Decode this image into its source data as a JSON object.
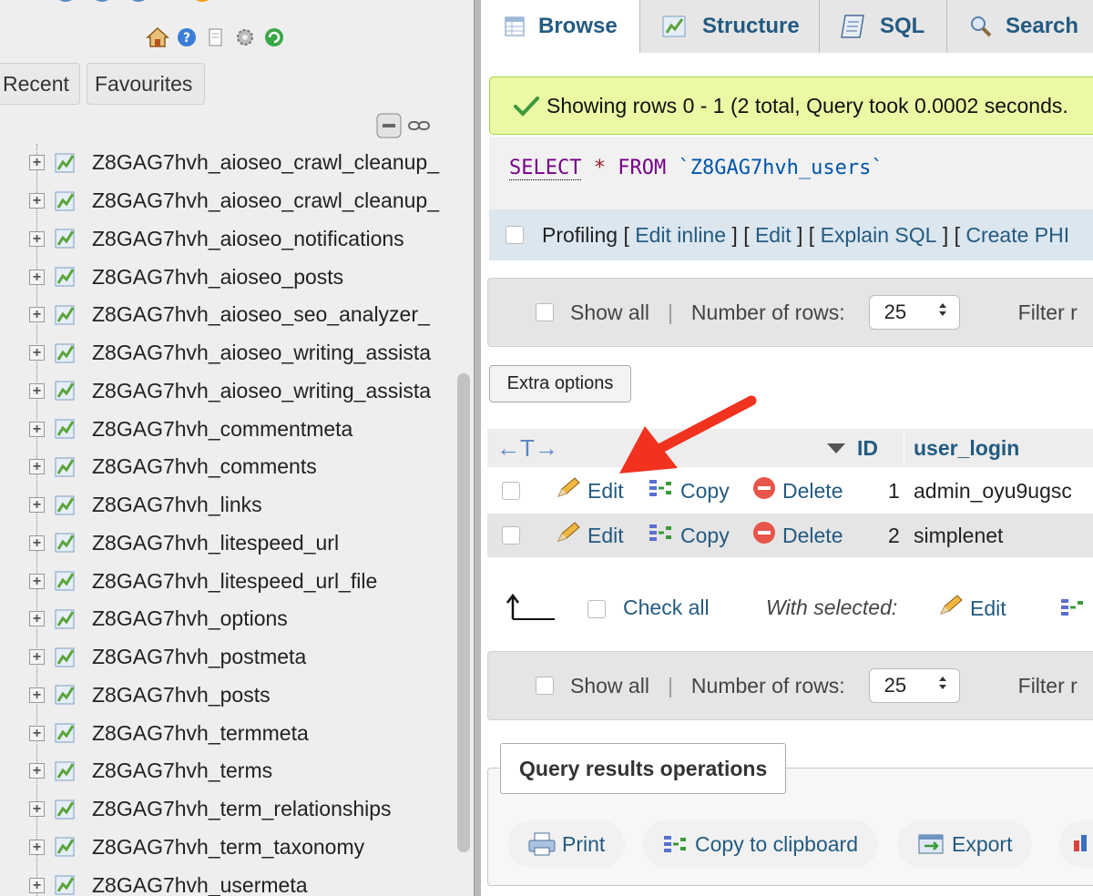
{
  "sidebar": {
    "nav_icons": [
      "home-icon",
      "help-icon",
      "docs-icon",
      "settings-icon",
      "reload-icon"
    ],
    "tabs": {
      "recent": "Recent",
      "favourites": "Favourites"
    },
    "tables": [
      "Z8GAG7hvh_aioseo_crawl_cleanup_",
      "Z8GAG7hvh_aioseo_crawl_cleanup_",
      "Z8GAG7hvh_aioseo_notifications",
      "Z8GAG7hvh_aioseo_posts",
      "Z8GAG7hvh_aioseo_seo_analyzer_",
      "Z8GAG7hvh_aioseo_writing_assista",
      "Z8GAG7hvh_aioseo_writing_assista",
      "Z8GAG7hvh_commentmeta",
      "Z8GAG7hvh_comments",
      "Z8GAG7hvh_links",
      "Z8GAG7hvh_litespeed_url",
      "Z8GAG7hvh_litespeed_url_file",
      "Z8GAG7hvh_options",
      "Z8GAG7hvh_postmeta",
      "Z8GAG7hvh_posts",
      "Z8GAG7hvh_termmeta",
      "Z8GAG7hvh_terms",
      "Z8GAG7hvh_term_relationships",
      "Z8GAG7hvh_term_taxonomy",
      "Z8GAG7hvh_usermeta"
    ]
  },
  "tabs": {
    "browse": "Browse",
    "structure": "Structure",
    "sql": "SQL",
    "search": "Search"
  },
  "message": "Showing rows 0 - 1 (2 total, Query took 0.0002 seconds.",
  "query": {
    "select": "SELECT",
    "star": "*",
    "from": "FROM",
    "table": "`Z8GAG7hvh_users`"
  },
  "profiling": {
    "label": "Profiling",
    "open": "[",
    "close": "]",
    "links": [
      "Edit inline",
      "Edit",
      "Explain SQL",
      "Create PHI"
    ]
  },
  "rows_nav": {
    "show_all": "Show all",
    "separator": "|",
    "num_rows_label": "Number of rows:",
    "num_rows_value": "25",
    "filter": "Filter r"
  },
  "extra_options": "Extra options",
  "table": {
    "sort_arrows": "←T→",
    "headers": {
      "id": "ID",
      "user_login": "user_login"
    },
    "actions": {
      "edit": "Edit",
      "copy": "Copy",
      "delete": "Delete"
    },
    "rows": [
      {
        "id": "1",
        "user_login": "admin_oyu9ugsc"
      },
      {
        "id": "2",
        "user_login": "simplenet"
      }
    ]
  },
  "bulk": {
    "check_all": "Check all",
    "with_selected": "With selected:",
    "edit": "Edit"
  },
  "query_ops": {
    "legend": "Query results operations",
    "print": "Print",
    "copy_clipboard": "Copy to clipboard",
    "export": "Export"
  },
  "colors": {
    "link": "#235a81",
    "success_bg": "#ebf8a4",
    "arrow": "#f0321e"
  }
}
